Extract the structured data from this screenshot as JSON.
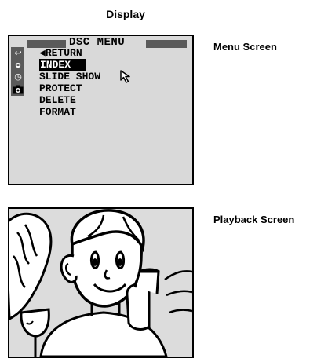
{
  "heading": "Display",
  "menu_screen": {
    "side_label": "Menu Screen",
    "title": "DSC MENU",
    "items": [
      {
        "label": "◀RETURN",
        "selected": false
      },
      {
        "label": "INDEX",
        "selected": true
      },
      {
        "label": "SLIDE SHOW",
        "selected": false
      },
      {
        "label": "PROTECT",
        "selected": false
      },
      {
        "label": "DELETE",
        "selected": false
      },
      {
        "label": "FORMAT",
        "selected": false
      }
    ]
  },
  "playback_screen": {
    "side_label": "Playback Screen"
  }
}
